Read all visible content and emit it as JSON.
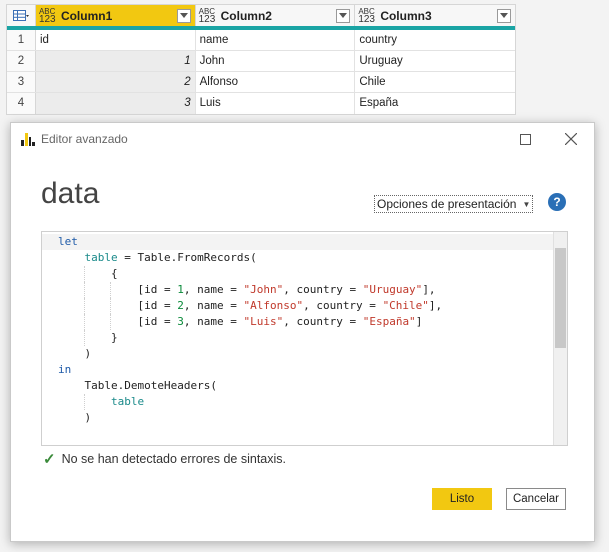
{
  "grid": {
    "columns": [
      {
        "name": "Column1",
        "type": "ABC 123"
      },
      {
        "name": "Column2",
        "type": "ABC 123"
      },
      {
        "name": "Column3",
        "type": "ABC 123"
      }
    ],
    "rows": [
      {
        "num": "1",
        "c1": "id",
        "c2": "name",
        "c3": "country"
      },
      {
        "num": "2",
        "c1": "1",
        "c2": "John",
        "c3": "Uruguay"
      },
      {
        "num": "3",
        "c1": "2",
        "c2": "Alfonso",
        "c3": "Chile"
      },
      {
        "num": "4",
        "c1": "3",
        "c2": "Luis",
        "c3": "España"
      }
    ]
  },
  "dialog": {
    "title": "Editor avanzado",
    "query_name": "data",
    "options_label": "Opciones de presentación",
    "help_label": "?",
    "code": {
      "let": "let",
      "table_var": "table",
      "eq_from": " = Table.FromRecords(",
      "brace_open": "{",
      "r1_id": "1",
      "r1_name": "\"John\"",
      "r1_country": "\"Uruguay\"",
      "r2_id": "2",
      "r2_name": "\"Alfonso\"",
      "r2_country": "\"Chile\"",
      "r3_id": "3",
      "r3_name": "\"Luis\"",
      "r3_country": "\"España\"",
      "rec_open": "[id = ",
      "rec_name": ", name = ",
      "rec_country": ", country = ",
      "rec_close_comma": "],",
      "rec_close": "]",
      "brace_close": "}",
      "paren_close": ")",
      "in": "in",
      "demote": "Table.DemoteHeaders(",
      "table_ref": "table"
    },
    "status_text": "No se han detectado errores de sintaxis.",
    "ok_label": "Listo",
    "cancel_label": "Cancelar"
  },
  "colors": {
    "accent": "#f2c811",
    "header_bar": "#1aa4a4",
    "keyword": "#1e5aa8",
    "string": "#c0392b",
    "number": "#0a8a3a",
    "variable": "#1a8a8a"
  },
  "icons": [
    "table-icon",
    "dropdown-icon",
    "power-bi-icon",
    "minimize-icon",
    "maximize-icon",
    "close-icon",
    "help-icon",
    "check-icon"
  ]
}
